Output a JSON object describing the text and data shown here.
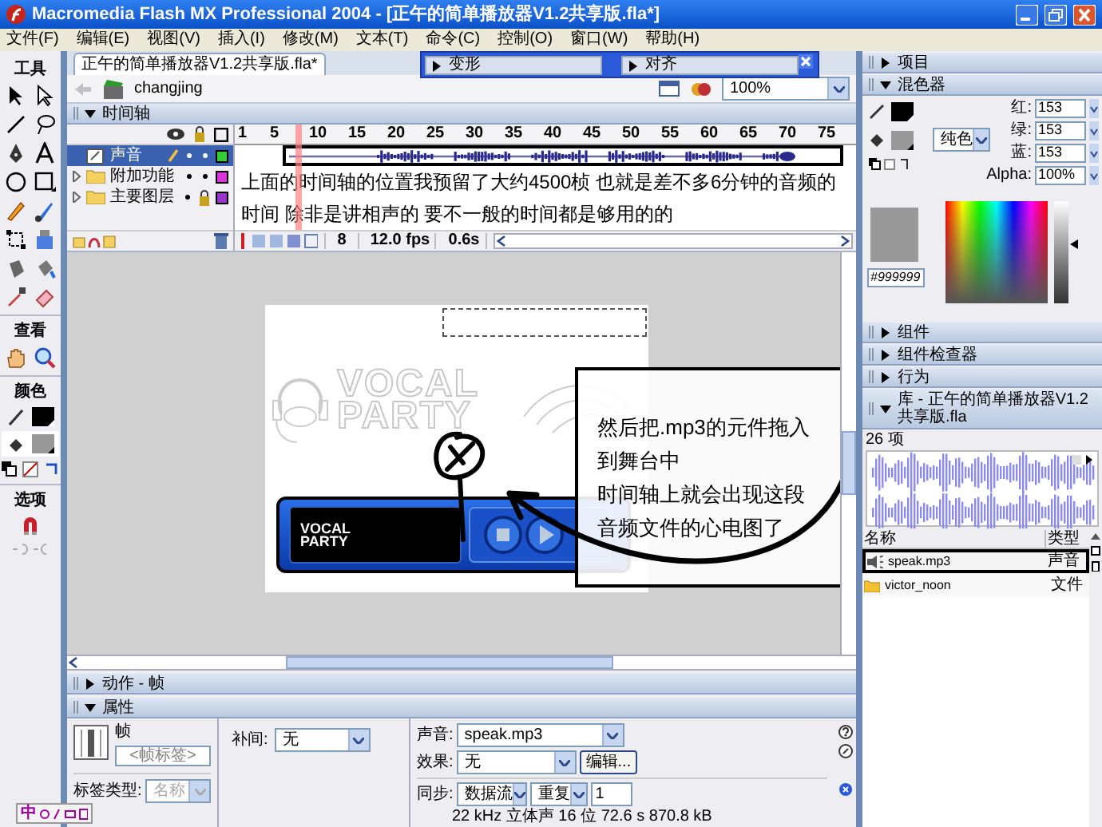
{
  "window": {
    "title": "Macromedia Flash MX Professional 2004 - [正午的简单播放器V1.2共享版.fla*]"
  },
  "menu": [
    "文件(F)",
    "编辑(E)",
    "视图(V)",
    "插入(I)",
    "修改(M)",
    "文本(T)",
    "命令(C)",
    "控制(O)",
    "窗口(W)",
    "帮助(H)"
  ],
  "toolbox": {
    "title": "工具",
    "sections": [
      "查看",
      "颜色",
      "选项"
    ],
    "ime": "中"
  },
  "document": {
    "tab": "正午的简单播放器V1.2共享版.fla*",
    "scene": "changjing",
    "zoom": "100%"
  },
  "timeline": {
    "title": "时间轴",
    "expanded": true,
    "layers": [
      {
        "name": "声音",
        "kind": "layer",
        "selected": true,
        "locked": false,
        "color": "#33cc33"
      },
      {
        "name": "附加功能",
        "kind": "folder",
        "selected": false,
        "locked": false,
        "color": "#dd33dd"
      },
      {
        "name": "主要图层",
        "kind": "folder",
        "selected": false,
        "locked": true,
        "color": "#9933cc"
      }
    ],
    "ruler": [
      "1",
      "5",
      "10",
      "15",
      "20",
      "25",
      "30",
      "35",
      "40",
      "45",
      "50",
      "55",
      "60",
      "65",
      "70",
      "75"
    ],
    "current_frame": "8",
    "fps": "12.0 fps",
    "time": "0.6s"
  },
  "timeline_note": [
    "上面的时间轴的位置我预留了大约4500桢  也就是差不多6分钟的音频的",
    "时间  除非是讲相声的  要不一般的时间都是够用的的"
  ],
  "floating_panel": {
    "items": [
      {
        "title": "变形",
        "expanded": false
      },
      {
        "title": "对齐",
        "expanded": false
      }
    ]
  },
  "stage": {
    "logo": [
      "VOCAL",
      "PARTY"
    ],
    "player_logo": [
      "VOCAL",
      "PARTY"
    ]
  },
  "callout": [
    "然后把.mp3的元件拖入",
    "到舞台中",
    "时间轴上就会出现这段",
    "音频文件的心电图了"
  ],
  "actions_panel": {
    "title": "动作 - 帧",
    "expanded": false
  },
  "properties": {
    "title": "属性",
    "expanded": true,
    "frame": "帧",
    "frame_label_placeholder": "<帧标签>",
    "label_type_label": "标签类型:",
    "label_type": "名称",
    "tween_label": "补间:",
    "tween": "无",
    "sound_label": "声音:",
    "sound": "speak.mp3",
    "effect_label": "效果:",
    "effect": "无",
    "edit_button": "编辑...",
    "sync_label": "同步:",
    "sync": "数据流",
    "repeat": "重复",
    "repeat_count": "1",
    "sound_info": "22 kHz 立体声 16 位 72.6 s 870.8 kB"
  },
  "right_panels": [
    {
      "title": "项目",
      "expanded": false
    },
    {
      "title": "混色器",
      "expanded": true
    }
  ],
  "mixer": {
    "channels": [
      {
        "label": "红:",
        "value": "153"
      },
      {
        "label": "绿:",
        "value": "153"
      },
      {
        "label": "蓝:",
        "value": "153"
      },
      {
        "label": "Alpha:",
        "value": "100%"
      }
    ],
    "fill_type": "纯色",
    "hex": "#999999",
    "brightness": {
      "level": 0.58
    }
  },
  "more_panels": [
    {
      "title": "组件",
      "expanded": false
    },
    {
      "title": "组件检查器",
      "expanded": false
    },
    {
      "title": "行为",
      "expanded": false
    }
  ],
  "library": {
    "title": "库 - 正午的简单播放器V1.2共享版.fla",
    "expanded": true,
    "count": "26 项",
    "columns": [
      "名称",
      "类型"
    ],
    "items": [
      {
        "name": "speak.mp3",
        "type": "声音",
        "kind": "sound",
        "selected": true
      },
      {
        "name": "victor_noon",
        "type": "文件",
        "kind": "folder",
        "selected": false
      }
    ]
  }
}
